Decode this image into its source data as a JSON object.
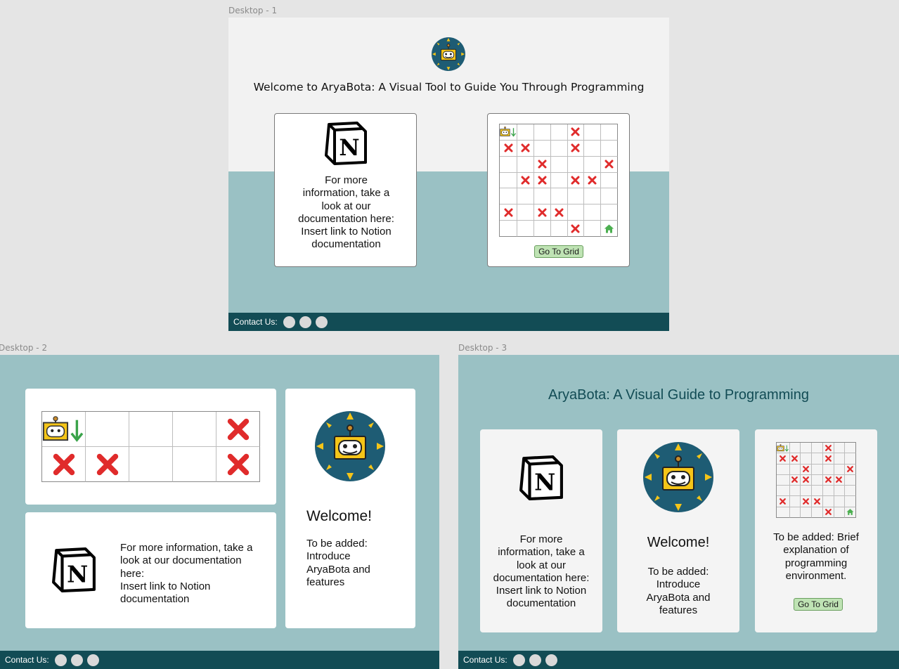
{
  "frames": {
    "desktop1": {
      "label": "Desktop - 1",
      "welcome_title": "Welcome to AryaBota: A Visual Tool to Guide You Through Programming",
      "doc_card": {
        "lines": [
          "For more",
          "information, take a",
          "look at our",
          "documentation here:",
          "Insert link to Notion",
          "documentation"
        ]
      },
      "grid_card": {
        "button_label": "Go To Grid"
      },
      "footer": {
        "contact_label": "Contact Us:"
      }
    },
    "desktop2": {
      "label": "Desktop - 2",
      "doc_card": {
        "lines": [
          "For more information, take a",
          "look at our documentation",
          "here:",
          "Insert link to Notion",
          "documentation"
        ]
      },
      "welcome_card": {
        "heading": "Welcome!",
        "lines": [
          "To be added:",
          "Introduce",
          "AryaBota and",
          "features"
        ]
      },
      "footer": {
        "contact_label": "Contact Us:"
      }
    },
    "desktop3": {
      "label": "Desktop - 3",
      "title": "AryaBota: A Visual Guide to Programming",
      "doc_card": {
        "lines": [
          "For more",
          "information, take a",
          "look at our",
          "documentation here:",
          "Insert link to Notion",
          "documentation"
        ]
      },
      "welcome_card": {
        "heading": "Welcome!",
        "lines": [
          "To be added:",
          "Introduce",
          "AryaBota and",
          "features"
        ]
      },
      "grid_card": {
        "lines": [
          "To be added: Brief",
          "explanation of",
          "programming",
          "environment."
        ],
        "button_label": "Go To Grid"
      },
      "footer": {
        "contact_label": "Contact Us:"
      }
    }
  },
  "grid7": {
    "rows": 7,
    "cols": 7,
    "cells": [
      [
        "robot",
        "",
        "",
        "",
        "x",
        "",
        ""
      ],
      [
        "x",
        "x",
        "",
        "",
        "x",
        "",
        ""
      ],
      [
        "",
        "",
        "x",
        "",
        "",
        "",
        "x"
      ],
      [
        "",
        "x",
        "x",
        "",
        "x",
        "x",
        ""
      ],
      [
        "",
        "",
        "",
        "",
        "",
        "",
        ""
      ],
      [
        "x",
        "",
        "x",
        "x",
        "",
        "",
        ""
      ],
      [
        "",
        "",
        "",
        "",
        "x",
        "",
        "home"
      ]
    ]
  },
  "grid2x5": {
    "rows": 2,
    "cols": 5,
    "cells": [
      [
        "robot",
        "",
        "",
        "",
        "x"
      ],
      [
        "x",
        "x",
        "",
        "",
        "x"
      ]
    ]
  },
  "colors": {
    "teal_bg": "#9ac1c4",
    "dark_teal": "#124c55",
    "logo_blue": "#1e5c74",
    "logo_yellow": "#f5c518",
    "x_red": "#e02b2b",
    "home_green": "#4caf50",
    "button_green": "#bfe3b4",
    "light_bg": "#f2f2f2"
  },
  "icons": [
    "robot-logo-icon",
    "notion-icon",
    "robot-icon",
    "down-arrow-icon",
    "x-mark-icon",
    "home-icon"
  ]
}
